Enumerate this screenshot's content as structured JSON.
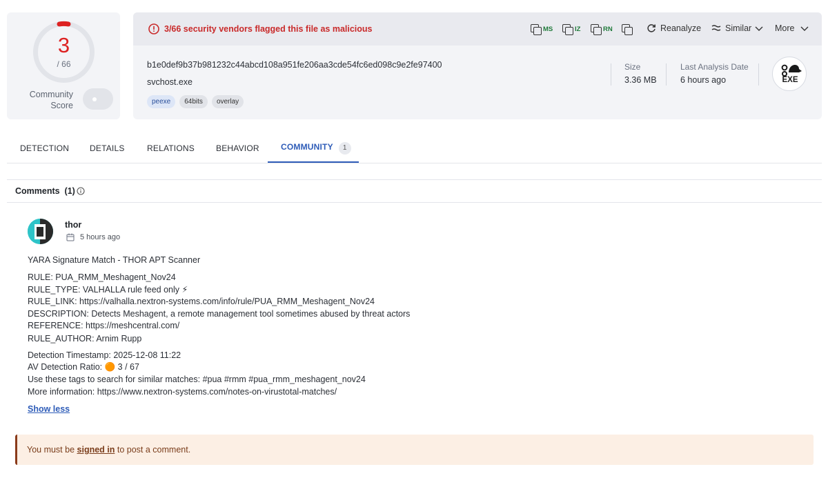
{
  "score": {
    "detections": "3",
    "total": "/ 66",
    "community_label": "Community Score"
  },
  "alert": {
    "text": "3/66 security vendors flagged this file as malicious"
  },
  "actions": {
    "ms_tag": "MS",
    "iz_tag": "IZ",
    "rn_tag": "RN",
    "reanalyze": "Reanalyze",
    "similar": "Similar",
    "more": "More"
  },
  "file": {
    "hash": "b1e0def9b37b981232c44abcd108a951fe206aa3cde54fc6ed098c9e2fe97400",
    "name": "svchost.exe",
    "tags": [
      "peexe",
      "64bits",
      "overlay"
    ],
    "size_label": "Size",
    "size_value": "3.36 MB",
    "date_label": "Last Analysis Date",
    "date_value": "6 hours ago",
    "type_badge": "EXE"
  },
  "tabs": [
    {
      "label": "DETECTION"
    },
    {
      "label": "DETAILS"
    },
    {
      "label": "RELATIONS"
    },
    {
      "label": "BEHAVIOR"
    },
    {
      "label": "COMMUNITY",
      "count": "1"
    }
  ],
  "comments": {
    "title": "Comments  (1)",
    "items": [
      {
        "author": "thor",
        "time": "5 hours ago",
        "lines": [
          "YARA Signature Match - THOR APT Scanner",
          "RULE: PUA_RMM_Meshagent_Nov24",
          "RULE_TYPE: VALHALLA rule feed only ⚡",
          "RULE_LINK: https://valhalla.nextron-systems.com/info/rule/PUA_RMM_Meshagent_Nov24",
          "DESCRIPTION: Detects Meshagent, a remote management tool sometimes abused by threat actors",
          "REFERENCE: https://meshcentral.com/",
          "RULE_AUTHOR: Arnim Rupp",
          "Detection Timestamp: 2025-12-08 11:22",
          "AV Detection Ratio: 🟠 3 / 67",
          "Use these tags to search for similar matches: #pua #rmm #pua_rmm_meshagent_nov24",
          "More information: https://www.nextron-systems.com/notes-on-virustotal-matches/"
        ],
        "show_less": "Show less"
      }
    ]
  },
  "notice": {
    "prefix": "You must be ",
    "link": "signed in",
    "suffix": " to post a comment."
  },
  "colors": {
    "malicious": "#dd2222",
    "accent": "#2e5cb8",
    "notice_bg": "#fcefe4"
  }
}
